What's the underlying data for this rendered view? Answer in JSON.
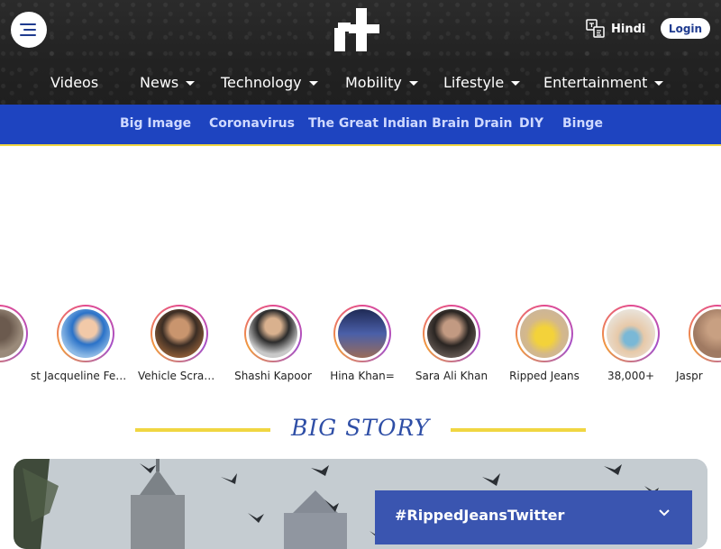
{
  "header": {
    "lang_label": "Hindi",
    "login_label": "Login"
  },
  "nav": {
    "items": [
      {
        "label": "Videos",
        "dropdown": false
      },
      {
        "label": "News",
        "dropdown": true
      },
      {
        "label": "Technology",
        "dropdown": true
      },
      {
        "label": "Mobility",
        "dropdown": true
      },
      {
        "label": "Lifestyle",
        "dropdown": true
      },
      {
        "label": "Entertainment",
        "dropdown": true
      }
    ]
  },
  "subnav": {
    "items": [
      "Big Image",
      "Coronavirus",
      "The Great Indian Brain Drain",
      "DIY",
      "Binge"
    ]
  },
  "stories": {
    "items": [
      {
        "label": "st"
      },
      {
        "label": "Jacqueline Fernandez"
      },
      {
        "label": "Vehicle Scrappage"
      },
      {
        "label": "Shashi Kapoor"
      },
      {
        "label": "Hina Khan="
      },
      {
        "label": "Sara Ali Khan"
      },
      {
        "label": "Ripped Jeans"
      },
      {
        "label": "38,000+"
      },
      {
        "label": "Jaspr"
      }
    ]
  },
  "big_story": {
    "title": "BIG STORY",
    "hashtag": "#RippedJeansTwitter"
  },
  "colors": {
    "header_bg": "#242424",
    "subnav_bg": "#1e44c0",
    "accent_yellow": "#f0d642",
    "title_blue": "#2e4ea6"
  },
  "icons": [
    "menu-icon",
    "site-logo",
    "language-icon",
    "caret-down-icon",
    "chevron-down-icon"
  ]
}
